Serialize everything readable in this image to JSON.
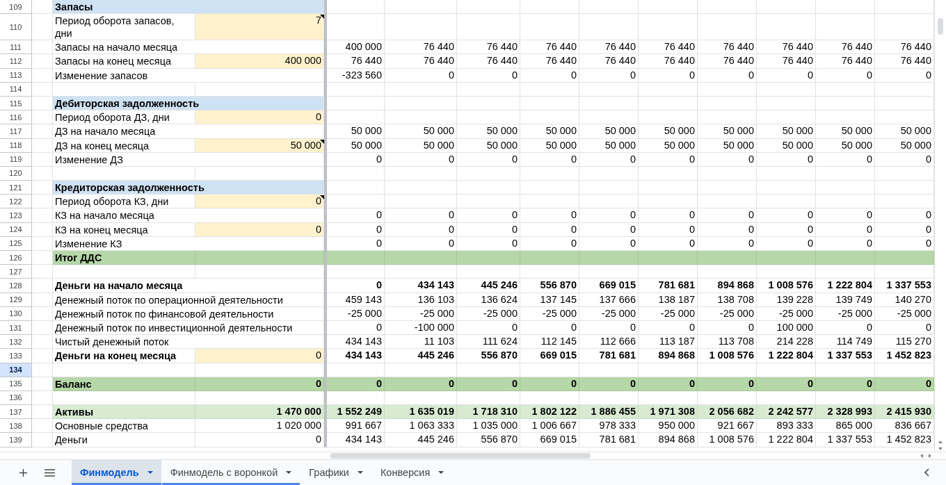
{
  "rows": [
    {
      "number": "109",
      "selected": false,
      "kind": "section",
      "label": "Запасы",
      "input": false,
      "note": false
    },
    {
      "number": "110",
      "selected": false,
      "kind": "plain",
      "label": "Период оборота запасов, дни",
      "column_c": "7",
      "input": true,
      "note": true
    },
    {
      "number": "111",
      "selected": false,
      "kind": "plain",
      "label": "Запасы на начало месяца",
      "input": false,
      "note": false,
      "values": [
        "400 000",
        "76 440",
        "76 440",
        "76 440",
        "76 440",
        "76 440",
        "76 440",
        "76 440",
        "76 440",
        "76 440"
      ]
    },
    {
      "number": "112",
      "selected": false,
      "kind": "plain",
      "label": "Запасы на конец месяца",
      "column_c": "400 000",
      "input": true,
      "note": false,
      "values": [
        "76 440",
        "76 440",
        "76 440",
        "76 440",
        "76 440",
        "76 440",
        "76 440",
        "76 440",
        "76 440",
        "76 440"
      ]
    },
    {
      "number": "113",
      "selected": false,
      "kind": "plain",
      "label": "Изменение запасов",
      "input": false,
      "note": false,
      "values": [
        "-323 560",
        "0",
        "0",
        "0",
        "0",
        "0",
        "0",
        "0",
        "0",
        "0"
      ]
    },
    {
      "number": "114",
      "selected": false,
      "kind": "blank",
      "input": false,
      "note": false
    },
    {
      "number": "115",
      "selected": false,
      "kind": "section",
      "label": "Дебиторская задолженность",
      "input": false,
      "note": false
    },
    {
      "number": "116",
      "selected": false,
      "kind": "plain",
      "label": "Период оборота ДЗ, дни",
      "column_c": "0",
      "input": true,
      "note": false
    },
    {
      "number": "117",
      "selected": false,
      "kind": "plain",
      "label": "ДЗ на начало месяца",
      "input": false,
      "note": false,
      "values": [
        "50 000",
        "50 000",
        "50 000",
        "50 000",
        "50 000",
        "50 000",
        "50 000",
        "50 000",
        "50 000",
        "50 000"
      ]
    },
    {
      "number": "118",
      "selected": false,
      "kind": "plain",
      "label": "ДЗ на конец месяца",
      "column_c": "50 000",
      "input": true,
      "note": true,
      "values": [
        "50 000",
        "50 000",
        "50 000",
        "50 000",
        "50 000",
        "50 000",
        "50 000",
        "50 000",
        "50 000",
        "50 000"
      ]
    },
    {
      "number": "119",
      "selected": false,
      "kind": "plain",
      "label": "Изменение ДЗ",
      "input": false,
      "note": false,
      "values": [
        "0",
        "0",
        "0",
        "0",
        "0",
        "0",
        "0",
        "0",
        "0",
        "0"
      ]
    },
    {
      "number": "120",
      "selected": false,
      "kind": "blank",
      "input": false,
      "note": false
    },
    {
      "number": "121",
      "selected": false,
      "kind": "section",
      "label": "Кредиторская задолженность",
      "input": false,
      "note": false
    },
    {
      "number": "122",
      "selected": false,
      "kind": "plain",
      "label": "Период оборота КЗ, дни",
      "column_c": "0",
      "input": true,
      "note": true
    },
    {
      "number": "123",
      "selected": false,
      "kind": "plain",
      "label": "КЗ на начало месяца",
      "input": false,
      "note": false,
      "values": [
        "0",
        "0",
        "0",
        "0",
        "0",
        "0",
        "0",
        "0",
        "0",
        "0"
      ]
    },
    {
      "number": "124",
      "selected": false,
      "kind": "plain",
      "label": "КЗ на конец месяца",
      "column_c": "0",
      "input": true,
      "note": false,
      "values": [
        "0",
        "0",
        "0",
        "0",
        "0",
        "0",
        "0",
        "0",
        "0",
        "0"
      ]
    },
    {
      "number": "125",
      "selected": false,
      "kind": "plain",
      "label": "Изменение КЗ",
      "input": false,
      "note": false,
      "values": [
        "0",
        "0",
        "0",
        "0",
        "0",
        "0",
        "0",
        "0",
        "0",
        "0"
      ]
    },
    {
      "number": "126",
      "selected": false,
      "kind": "total",
      "label": "Итог ДДС",
      "input": false,
      "note": false
    },
    {
      "number": "127",
      "selected": false,
      "kind": "blank",
      "input": false,
      "note": false
    },
    {
      "number": "128",
      "selected": false,
      "kind": "bold",
      "label": "Деньги на начало месяца",
      "input": false,
      "note": false,
      "values": [
        "0",
        "434 143",
        "445 246",
        "556 870",
        "669 015",
        "781 681",
        "894 868",
        "1 008 576",
        "1 222 804",
        "1 337 553"
      ]
    },
    {
      "number": "129",
      "selected": false,
      "kind": "plain",
      "label": "Денежный поток по операционной деятельности",
      "input": false,
      "note": false,
      "values": [
        "459 143",
        "136 103",
        "136 624",
        "137 145",
        "137 666",
        "138 187",
        "138 708",
        "139 228",
        "139 749",
        "140 270"
      ]
    },
    {
      "number": "130",
      "selected": false,
      "kind": "plain",
      "label": "Денежный поток по финансовой деятельности",
      "input": false,
      "note": false,
      "values": [
        "-25 000",
        "-25 000",
        "-25 000",
        "-25 000",
        "-25 000",
        "-25 000",
        "-25 000",
        "-25 000",
        "-25 000",
        "-25 000"
      ]
    },
    {
      "number": "131",
      "selected": false,
      "kind": "plain",
      "label": "Денежный поток по инвестиционной деятельности",
      "input": false,
      "note": false,
      "values": [
        "0",
        "-100 000",
        "0",
        "0",
        "0",
        "0",
        "0",
        "100 000",
        "0",
        "0"
      ]
    },
    {
      "number": "132",
      "selected": false,
      "kind": "plain",
      "label": "Чистый денежный поток",
      "input": false,
      "note": false,
      "values": [
        "434 143",
        "11 103",
        "111 624",
        "112 145",
        "112 666",
        "113 187",
        "113 708",
        "214 228",
        "114 749",
        "115 270"
      ]
    },
    {
      "number": "133",
      "selected": false,
      "kind": "bold",
      "label": "Деньги на конец месяца",
      "column_c": "0",
      "input": true,
      "note": false,
      "values": [
        "434 143",
        "445 246",
        "556 870",
        "669 015",
        "781 681",
        "894 868",
        "1 008 576",
        "1 222 804",
        "1 337 553",
        "1 452 823"
      ]
    },
    {
      "number": "134",
      "selected": true,
      "kind": "blank",
      "input": false,
      "note": false
    },
    {
      "number": "135",
      "selected": false,
      "kind": "total",
      "label": "Баланс",
      "column_c": "0",
      "input": false,
      "note": false,
      "values": [
        "0",
        "0",
        "0",
        "0",
        "0",
        "0",
        "0",
        "0",
        "0",
        "0"
      ]
    },
    {
      "number": "136",
      "selected": false,
      "kind": "blank",
      "input": false,
      "note": false
    },
    {
      "number": "137",
      "selected": false,
      "kind": "subtotal",
      "label": "Активы",
      "column_c": "1 470 000",
      "input": false,
      "note": false,
      "values": [
        "1 552 249",
        "1 635 019",
        "1 718 310",
        "1 802 122",
        "1 886 455",
        "1 971 308",
        "2 056 682",
        "2 242 577",
        "2 328 993",
        "2 415 930"
      ]
    },
    {
      "number": "138",
      "selected": false,
      "kind": "plain",
      "label": "Основные средства",
      "column_c": "1 020 000",
      "input": false,
      "note": false,
      "values": [
        "991 667",
        "1 063 333",
        "1 035 000",
        "1 006 667",
        "978 333",
        "950 000",
        "921 667",
        "893 333",
        "865 000",
        "836 667"
      ]
    },
    {
      "number": "139",
      "selected": false,
      "kind": "plain",
      "label": "Деньги",
      "column_c": "0",
      "input": false,
      "note": false,
      "values": [
        "434 143",
        "445 246",
        "556 870",
        "669 015",
        "781 681",
        "894 868",
        "1 008 576",
        "1 222 804",
        "1 337 553",
        "1 452 823"
      ]
    }
  ],
  "tabs": [
    {
      "label": "Финмодель",
      "selected": true,
      "color": "#4a86e8"
    },
    {
      "label": "Финмодель с воронкой",
      "selected": false,
      "color": "#4a86e8"
    },
    {
      "label": "Графики",
      "selected": false
    },
    {
      "label": "Конверсия",
      "selected": false
    }
  ]
}
